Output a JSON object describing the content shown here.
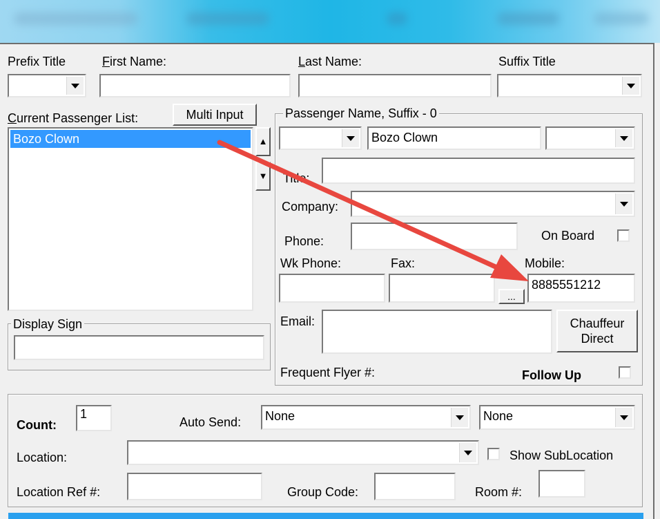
{
  "header": {
    "prefix_title_label": "Prefix Title",
    "first_name_label_key": "F",
    "first_name_label_rest": "irst Name:",
    "last_name_label_key": "L",
    "last_name_label_rest": "ast Name:",
    "suffix_title_label": "Suffix Title",
    "prefix_title_value": "",
    "first_name_value": "",
    "last_name_value": "",
    "suffix_title_value": ""
  },
  "passenger_list": {
    "label_key": "C",
    "label_rest": "urrent Passenger List:",
    "multi_input_label": "Multi Input",
    "items": [
      "Bozo Clown"
    ],
    "scroll_up_glyph": "▲",
    "scroll_down_glyph": "▼"
  },
  "display_sign": {
    "title": "Display Sign",
    "value": ""
  },
  "passenger_group": {
    "title": "Passenger Name, Suffix - 0",
    "prefix_value": "",
    "name_value": "Bozo Clown",
    "suffix_value": "",
    "title_label": "Title:",
    "title_value": "",
    "company_label": "Company:",
    "company_value": "",
    "phone_label": "Phone:",
    "phone_value": "",
    "on_board_label": "On Board",
    "wk_phone_label": "Wk Phone:",
    "wk_phone_value": "",
    "fax_label": "Fax:",
    "fax_value": "",
    "ellipsis_label": "...",
    "mobile_label": "Mobile:",
    "mobile_value": "8885551212",
    "email_label": "Email:",
    "email_value": "",
    "chauffeur_line1": "Chauffeur",
    "chauffeur_line2": "Direct",
    "frequent_flyer_label": "Frequent Flyer #:",
    "follow_up_label": "Follow Up"
  },
  "bottom": {
    "count_label": "Count:",
    "count_value": "1",
    "auto_send_label": "Auto Send:",
    "auto_send_value": "None",
    "auto_send_value2": "None",
    "location_label": "Location:",
    "location_value": "",
    "show_sublocation_label": "Show SubLocation",
    "location_ref_label": "Location Ref #:",
    "location_ref_value": "",
    "group_code_label": "Group Code:",
    "group_code_value": "",
    "room_label": "Room #:",
    "room_value": ""
  },
  "colors": {
    "annotation_arrow": "#e8473f",
    "selection": "#3399ff",
    "title_bar": "#1fb6e6"
  },
  "icons": {
    "dropdown": "chevron-down-icon",
    "annotation": "arrow-annotation-icon"
  }
}
